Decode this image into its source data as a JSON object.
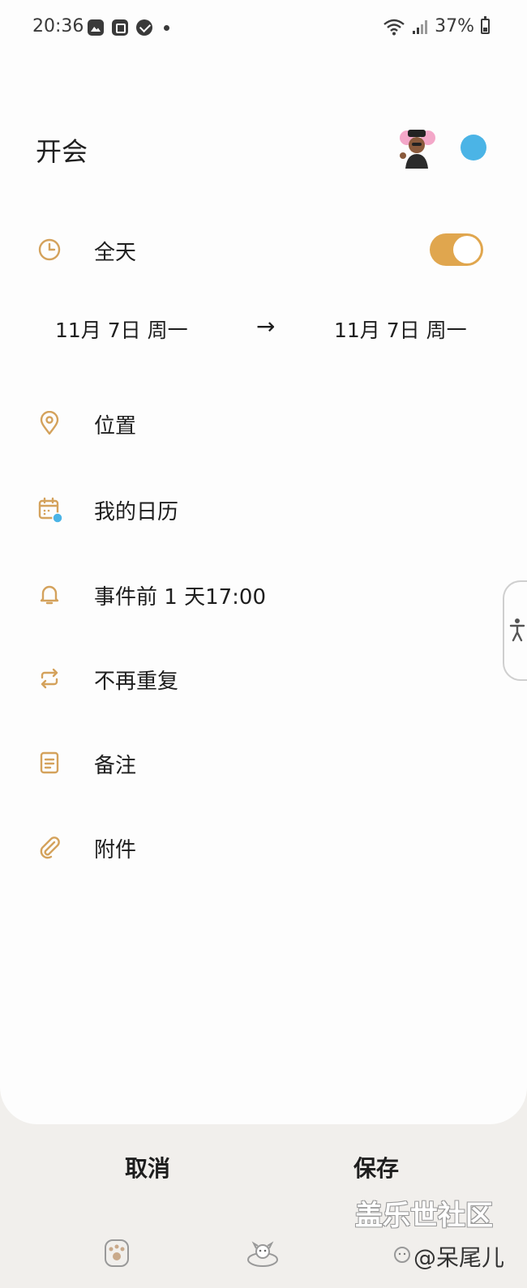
{
  "status_bar": {
    "time": "20:36",
    "battery": "37%"
  },
  "event": {
    "title": "开会",
    "color": "#4bb4e6"
  },
  "all_day": {
    "label": "全天",
    "enabled": true
  },
  "dates": {
    "start": "11月 7日 周一",
    "arrow": "→",
    "end": "11月 7日 周一"
  },
  "fields": {
    "location": "位置",
    "calendar": "我的日历",
    "reminder": "事件前 1 天17:00",
    "repeat": "不再重复",
    "notes": "备注",
    "attachments": "附件"
  },
  "actions": {
    "cancel": "取消",
    "save": "保存"
  },
  "watermark": {
    "line1": "盖乐世社区",
    "line2": "@呆尾儿"
  },
  "colors": {
    "accent": "#e0a64e",
    "calendar_dot": "#4bb4e6",
    "background": "#fdfdfd",
    "bottom_bar": "#f1efec"
  }
}
